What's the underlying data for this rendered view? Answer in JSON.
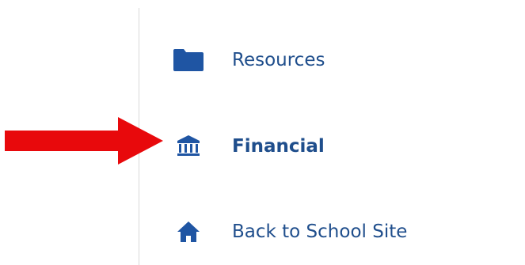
{
  "colors": {
    "nav_text": "#1f4e8c",
    "nav_icon": "#1f55a3",
    "arrow": "#e8090c",
    "divider": "#d9d9d9"
  },
  "nav": {
    "items": [
      {
        "label": "Resources",
        "icon": "folder-icon",
        "active": false
      },
      {
        "label": "Financial",
        "icon": "bank-icon",
        "active": true
      },
      {
        "label": "Back to School Site",
        "icon": "home-icon",
        "active": false
      }
    ]
  }
}
